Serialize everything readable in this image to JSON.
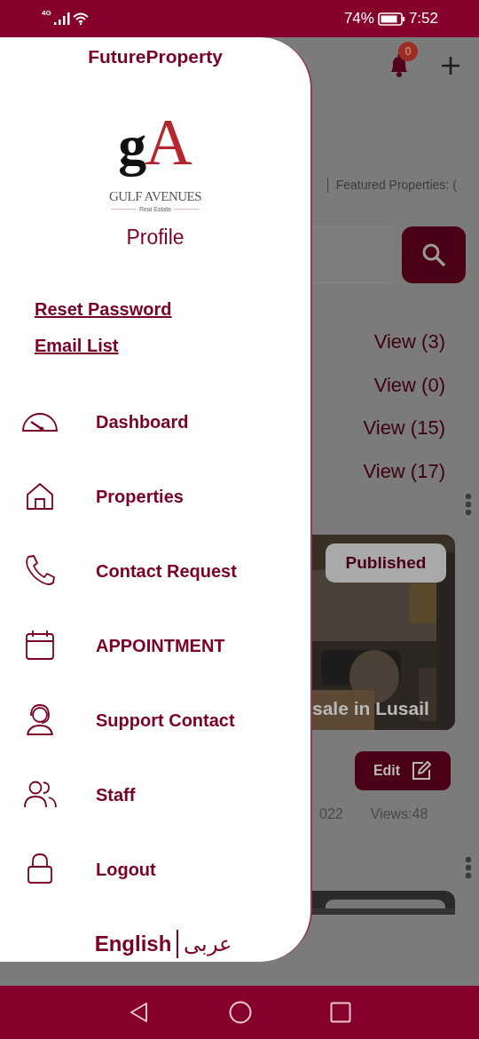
{
  "status_bar": {
    "network": "4G",
    "battery": "74%",
    "time": "7:52"
  },
  "drawer": {
    "title": "FutureProperty",
    "logo": {
      "monogram": [
        "g",
        "A"
      ],
      "name": "GULF AVENUES",
      "tagline": "Real Estate"
    },
    "profile": "Profile",
    "links": [
      "Reset Password",
      "Email List"
    ],
    "menu": [
      {
        "label": "Dashboard",
        "kind": "gauge"
      },
      {
        "label": "Properties",
        "kind": "house"
      },
      {
        "label": "Contact Request",
        "kind": "phone"
      },
      {
        "label": "APPOINTMENT",
        "kind": "calendar"
      },
      {
        "label": "Support Contact",
        "kind": "headset"
      },
      {
        "label": "Staff",
        "kind": "people"
      },
      {
        "label": "Logout",
        "kind": "lock"
      }
    ],
    "language": {
      "english": "English",
      "arabic": "عربى"
    }
  },
  "page": {
    "notification_count": "0",
    "stats": "│ Featured Properties: (",
    "views": [
      "View (3)",
      "View (0)",
      "View (15)",
      "View (17)"
    ],
    "card": {
      "status": "Published",
      "title": "sale in Lusail",
      "edit": "Edit",
      "date": "022",
      "views": "Views:48"
    }
  }
}
